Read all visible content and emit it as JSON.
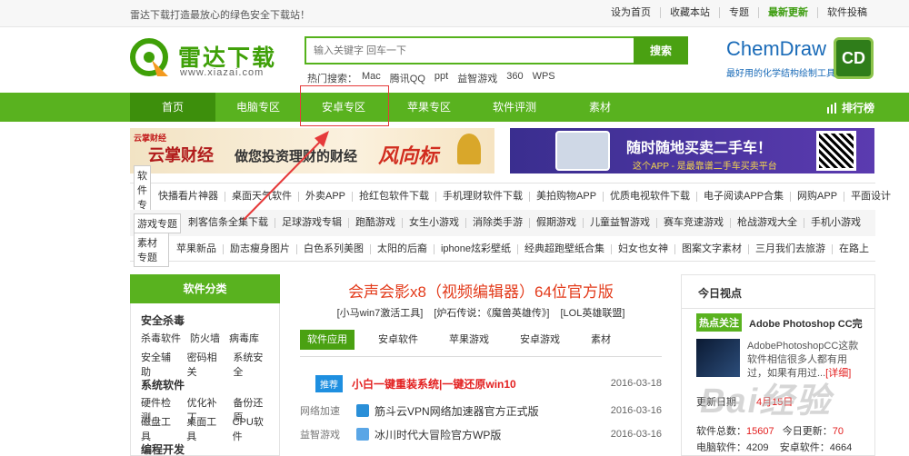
{
  "topbar": {
    "slogan": "雷达下载打造最放心的绿色安全下载站！",
    "links": [
      "设为首页",
      "收藏本站",
      "专题",
      "最新更新",
      "软件投稿"
    ]
  },
  "header": {
    "logo_text": "雷达下载",
    "logo_url": "www.xiazai.com",
    "search_placeholder": "输入关键字 回车一下",
    "search_button": "搜索",
    "hot_label": "热门搜索：",
    "hot_items": [
      "Mac",
      "腾讯QQ",
      "ppt",
      "益智游戏",
      "360",
      "WPS"
    ],
    "ad_title": "ChemDraw",
    "ad_sub": "最好用的化学结构绘制工具",
    "ad_badge": "CD"
  },
  "nav": {
    "items": [
      "首页",
      "电脑专区",
      "安卓专区",
      "苹果专区",
      "软件评测",
      "素材"
    ],
    "rank": "排行榜"
  },
  "banner1": {
    "brand": "云掌财经",
    "big": "云掌财经",
    "mid": "做您投资理财的财经",
    "sig": "风向标"
  },
  "banner2": {
    "t1": "随时随地买卖二手车！",
    "t2": "这个APP - 是最靠谱二手车买卖平台"
  },
  "tag_rows": [
    {
      "cat": "软件专题",
      "items": [
        "快播看片神器",
        "桌面天气软件",
        "外卖APP",
        "抢红包软件下载",
        "手机理财软件下载",
        "美拍购物APP",
        "优质电视软件下载",
        "电子阅读APP合集",
        "网购APP",
        "平面设计"
      ]
    },
    {
      "cat": "游戏专题",
      "items": [
        "刺客信条全集下载",
        "足球游戏专辑",
        "跑酷游戏",
        "女生小游戏",
        "消除类手游",
        "假期游戏",
        "儿童益智游戏",
        "赛车竞速游戏",
        "枪战游戏大全",
        "手机小游戏"
      ]
    },
    {
      "cat": "素材专题",
      "items": [
        "苹果新品",
        "励志瘦身图片",
        "白色系列美图",
        "太阳的后裔",
        "iphone炫彩壁纸",
        "经典超跑壁纸合集",
        "妇女也女神",
        "图案文字素材",
        "三月我们去旅游",
        "在路上"
      ]
    }
  ],
  "sidebar": {
    "title": "软件分类",
    "sections": [
      {
        "name": "安全杀毒",
        "rows": [
          [
            "杀毒软件",
            "防火墙",
            "病毒库"
          ],
          [
            "安全辅助",
            "密码相关",
            "系统安全"
          ]
        ]
      },
      {
        "name": "系统软件",
        "rows": [
          [
            "硬件检测",
            "优化补丁",
            "备份还原"
          ],
          [
            "磁盘工具",
            "桌面工具",
            "CPU软件"
          ]
        ]
      },
      {
        "name": "编程开发",
        "rows": []
      }
    ]
  },
  "center": {
    "title": "会声会影x8（视频编辑器）64位官方版",
    "sub": [
      "[小马win7激活工具]",
      "[炉石传说：《魔兽英雄传》]",
      "[LOL英雄联盟]"
    ],
    "tabs": [
      "软件应用",
      "安卓软件",
      "苹果游戏",
      "安卓游戏",
      "素材"
    ],
    "news": [
      {
        "badge": "推荐",
        "cat": "",
        "title": "小白一键重装系统|一键还原win10",
        "date": "2016-03-18"
      },
      {
        "badge": "",
        "cat": "网络加速",
        "title": "筋斗云VPN网络加速器官方正式版",
        "date": "2016-03-16"
      },
      {
        "badge": "",
        "cat": "益智游戏",
        "title": "冰川时代大冒险官方WP版",
        "date": "2016-03-16"
      }
    ]
  },
  "right": {
    "title": "今日视点",
    "hot_badge": "热点关注",
    "hot_title": "Adobe Photoshop CC完",
    "desc": "AdobePhotoshopCC这款软件相信很多人都有用过，如果有用过...",
    "more": "[详细]",
    "stat_label": "更新日期",
    "stat_date": "4月15日",
    "stat1_label": "软件总数：",
    "stat1_value": "15607",
    "stat1b_label": "今日更新：",
    "stat1b_value": "70",
    "stat2a": "电脑软件：4209",
    "stat2b": "安卓软件：4664"
  },
  "watermark": "Bai经验",
  "colors": {
    "brand_green": "#59b21f",
    "accent_red": "#e32020",
    "badge_blue": "#1e8fe0"
  }
}
